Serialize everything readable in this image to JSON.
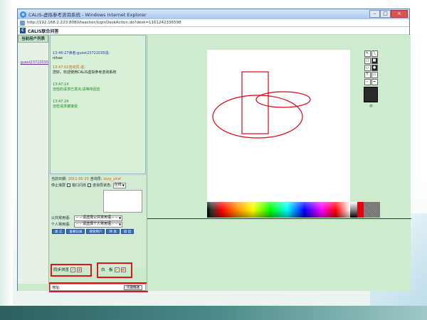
{
  "window": {
    "title": "CALIS-虚拟参考咨询系统 - Windows Internet Explorer",
    "address": "http://192.168.2.223:8080/teacher/loginDeskAction.do?desk=1161242336598",
    "header_title": "CALIS联合问答"
  },
  "user_list": {
    "heading": "当前用户列表",
    "user": "guest23722035"
  },
  "chat": {
    "messages": [
      {
        "meta": "13:46:27读者:guest23722035说:",
        "body": "nihao"
      },
      {
        "meta": "13:47:02咨询员:说:",
        "body": "您好，欢迎使用CALIS虚拟参考咨询系统"
      },
      {
        "meta": "13:47:14",
        "body": "自检的请求已发出,请等待回应"
      },
      {
        "meta": "13:47:24",
        "body": "自检请求被接受"
      }
    ]
  },
  "controls": {
    "date_label": "当前日期:",
    "date_value": "2011-05-25",
    "consultant_label": "咨询员:",
    "consultant_value": "zxzy_uhsf",
    "scroll_label": "停止滚屏",
    "window_flash_label": "窗口闪烁",
    "consultant_status_label": "咨询员状态:",
    "status_value": "在线",
    "public_phrase_label": "公共常用语:",
    "public_phrase_value": "－－请选择公共常用语－－",
    "personal_phrase_label": "个人常用语:",
    "personal_phrase_value": "－－请选择个人常用语－－",
    "buttons": [
      "发 言",
      "查看记录",
      "接受用户",
      "转 发",
      "退 出"
    ],
    "sync_browse": "同步浏览",
    "whiteboard": "白　板",
    "address_label": "地址:",
    "open_page": "页面推送"
  },
  "icons": {
    "check": "check-icon",
    "stop": "stop-icon"
  },
  "colors": {
    "highlight_red": "#e0151b",
    "drawing_red": "#e30010"
  }
}
